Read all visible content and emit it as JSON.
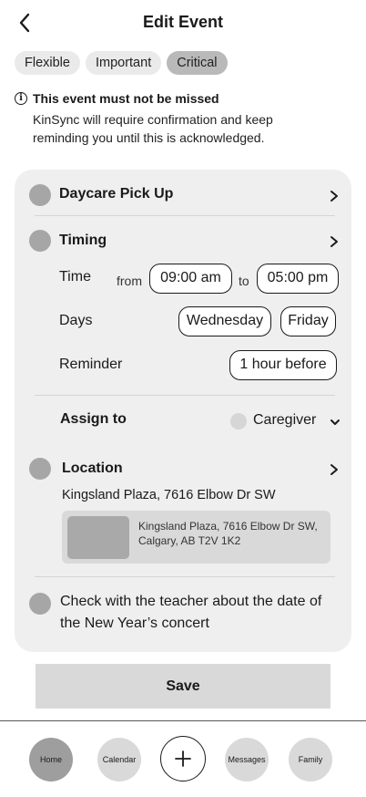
{
  "header": {
    "title": "Edit Event",
    "back_icon": "chevron-left-icon"
  },
  "priority": {
    "options": [
      "Flexible",
      "Important",
      "Critical"
    ],
    "selected": "Critical"
  },
  "notice": {
    "icon": "info-icon",
    "icon_glyph": "i",
    "heading": "This event must not be missed",
    "body": "KinSync will require confirmation and keep reminding you until this is acknowledged."
  },
  "event": {
    "name": "Daycare Pick Up",
    "timing": {
      "label": "Timing",
      "time_label": "Time",
      "from_word": "from",
      "from_value": "09:00 am",
      "to_word": "to",
      "to_value": "05:00 pm",
      "days_label": "Days",
      "days": [
        "Wednesday",
        "Friday"
      ],
      "reminder_label": "Reminder",
      "reminder_value": "1 hour before"
    },
    "assign": {
      "label": "Assign to",
      "value": "Caregiver"
    },
    "location": {
      "label": "Location",
      "address": "Kingsland Plaza, 7616 Elbow Dr SW",
      "map_address": "Kingsland Plaza, 7616 Elbow Dr SW, Calgary, AB T2V 1K2"
    },
    "note": "Check with the teacher about the date of the New Year’s concert"
  },
  "save_label": "Save",
  "nav": {
    "items": [
      "Home",
      "Calendar",
      "Messages",
      "Family"
    ],
    "active": "Home",
    "add_icon": "plus-icon"
  },
  "colors": {
    "card_bg": "#efefef",
    "chip_bg": "#eaeaea",
    "chip_active_bg": "#b9b9b9",
    "save_bg": "#d9d9d9",
    "nav_active_bg": "#9e9e9e"
  }
}
